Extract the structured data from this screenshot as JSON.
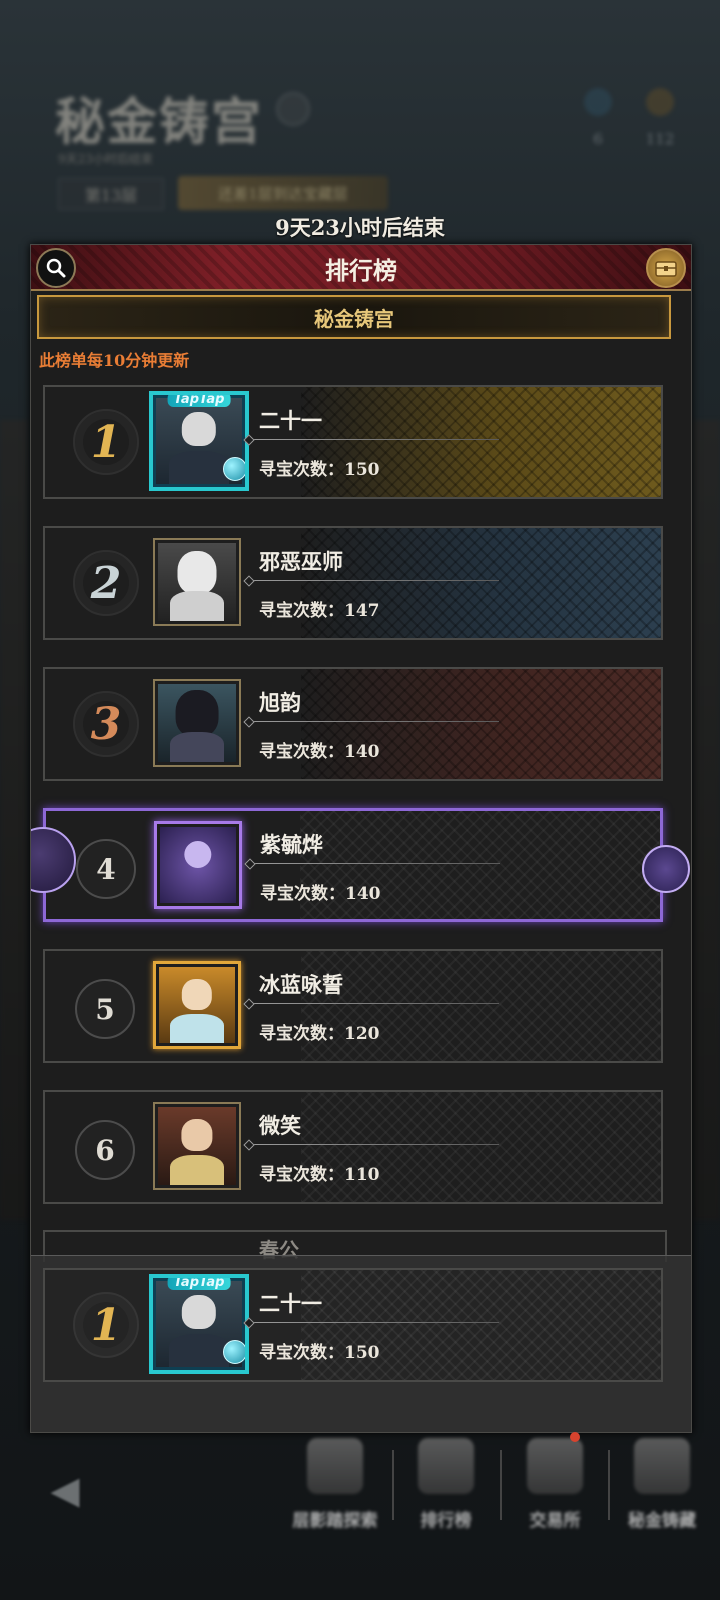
{
  "background": {
    "title": "秘金铸宫",
    "subtitle": "9天23小时后结束",
    "floor": "第13层",
    "tip": "还差1层到达宝藏层",
    "resources": [
      "6",
      "112"
    ]
  },
  "end_time": "9天23小时后结束",
  "panel": {
    "title": "排行榜",
    "subtitle": "秘金铸宫",
    "update_note": "此榜单每10分钟更新",
    "count_label": "寻宝次数：",
    "entries": [
      {
        "rank": "1",
        "name": "二十一",
        "count": "150"
      },
      {
        "rank": "2",
        "name": "邪恶巫师",
        "count": "147"
      },
      {
        "rank": "3",
        "name": "旭韵",
        "count": "140"
      },
      {
        "rank": "4",
        "name": "紫毓烨",
        "count": "140"
      },
      {
        "rank": "5",
        "name": "冰蓝咏誓",
        "count": "120"
      },
      {
        "rank": "6",
        "name": "微笑",
        "count": "110"
      }
    ],
    "partial_name": "春公",
    "self": {
      "rank": "1",
      "name": "二十一",
      "count": "150"
    }
  },
  "nav": {
    "items": [
      "层影踏探索",
      "排行榜",
      "交易所",
      "秘金铸藏"
    ]
  },
  "colors": {
    "gold": "#e2b553",
    "silver": "#c9d3d6",
    "bronze": "#d48a5a",
    "accent_orange": "#e97d35",
    "purple": "#8d68d6"
  }
}
